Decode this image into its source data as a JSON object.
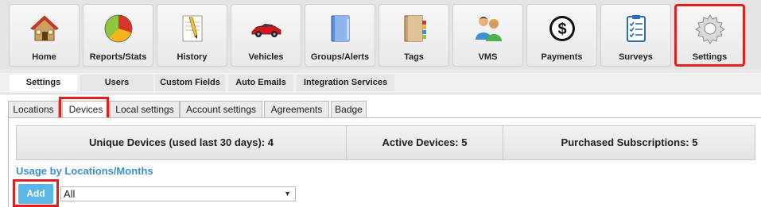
{
  "toolbar": {
    "items": [
      {
        "label": "Home",
        "icon": "house-icon"
      },
      {
        "label": "Reports/Stats",
        "icon": "pie-chart-icon"
      },
      {
        "label": "History",
        "icon": "notepad-pencil-icon"
      },
      {
        "label": "Vehicles",
        "icon": "red-car-icon"
      },
      {
        "label": "Groups/Alerts",
        "icon": "blue-folder-icon"
      },
      {
        "label": "Tags",
        "icon": "tag-folder-icon"
      },
      {
        "label": "VMS",
        "icon": "users-icon"
      },
      {
        "label": "Payments",
        "icon": "dollar-circle-icon"
      },
      {
        "label": "Surveys",
        "icon": "clipboard-checklist-icon"
      },
      {
        "label": "Settings",
        "icon": "gear-icon"
      }
    ],
    "selected": "Settings"
  },
  "subtabs": {
    "items": [
      "Settings",
      "Users",
      "Custom Fields",
      "Auto Emails",
      "Integration Services"
    ],
    "active": "Settings"
  },
  "tabs": {
    "items": [
      "Locations",
      "Devices",
      "Local settings",
      "Account settings",
      "Agreements",
      "Badge"
    ],
    "active": "Devices"
  },
  "stats": {
    "unique": "Unique Devices (used last 30 days): 4",
    "active": "Active Devices: 5",
    "purchased": "Purchased Subscriptions: 5"
  },
  "usage": {
    "title": "Usage by Locations/Months",
    "add_label": "Add",
    "select_value": "All"
  },
  "colors": {
    "highlight": "#e0201f",
    "accent_blue": "#3b8fd0",
    "button_blue": "#5ab6e6"
  }
}
